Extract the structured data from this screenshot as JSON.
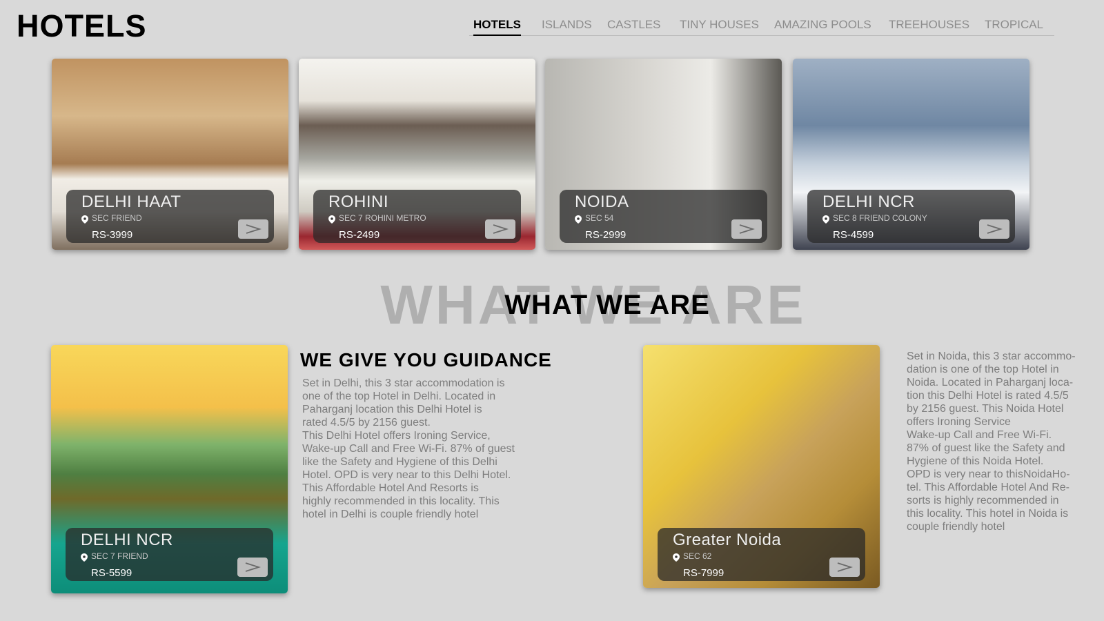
{
  "header": {
    "logo": "HOTELS",
    "nav": [
      "HOTELS",
      "ISLANDS",
      "CASTLES",
      "TINY HOUSES",
      "AMAZING POOLS",
      "TREEHOUSES",
      "TROPICAL"
    ],
    "active_tab": "HOTELS"
  },
  "featured": [
    {
      "place": "DELHI HAAT",
      "address": "SEC FRIEND",
      "price": "RS-3999"
    },
    {
      "place": "ROHINI",
      "address": "SEC 7 ROHINI METRO",
      "price": "RS-2499"
    },
    {
      "place": "NOIDA",
      "address": "SEC 54",
      "price": "RS-2999"
    },
    {
      "place": "DELHI NCR",
      "address": "SEC 8 FRIEND COLONY",
      "price": "RS-4599"
    }
  ],
  "about": {
    "ghost_heading": "WHAT WE ARE",
    "heading": "WHAT WE ARE",
    "subheading": "WE GIVE YOU GUIDANCE",
    "card_left": {
      "place": "DELHI NCR",
      "address": "SEC 7 FRIEND",
      "price": "RS-5599"
    },
    "text_left": "Set in Delhi, this 3 star accommodation is\none of the top Hotel in Delhi. Located in\nPaharganj location this Delhi Hotel is\nrated 4.5/5 by 2156 guest.\nThis Delhi Hotel offers Ironing Service,\nWake-up Call and Free Wi-Fi. 87% of guest\nlike the Safety and Hygiene of this Delhi\nHotel. OPD is very near to this Delhi Hotel.\nThis Affordable Hotel And Resorts is\nhighly recommended in this locality. This\nhotel in Delhi is couple friendly hotel",
    "card_right": {
      "place": "Greater Noida",
      "address": "SEC 62",
      "price": "RS-7999"
    },
    "text_right": "Set in Noida, this 3 star accommo-\ndation is one of the top Hotel in\nNoida. Located in Paharganj loca-\ntion this Delhi Hotel is rated 4.5/5\nby 2156 guest. This Noida Hotel\noffers Ironing Service\nWake-up Call and Free Wi-Fi.\n87% of guest like the Safety and\nHygiene of this Noida Hotel.\nOPD is very near to thisNoidaHo-\ntel. This Affordable Hotel And Re-\nsorts is highly recommended in\nthis locality. This hotel in Noida is\ncouple friendly hotel"
  }
}
